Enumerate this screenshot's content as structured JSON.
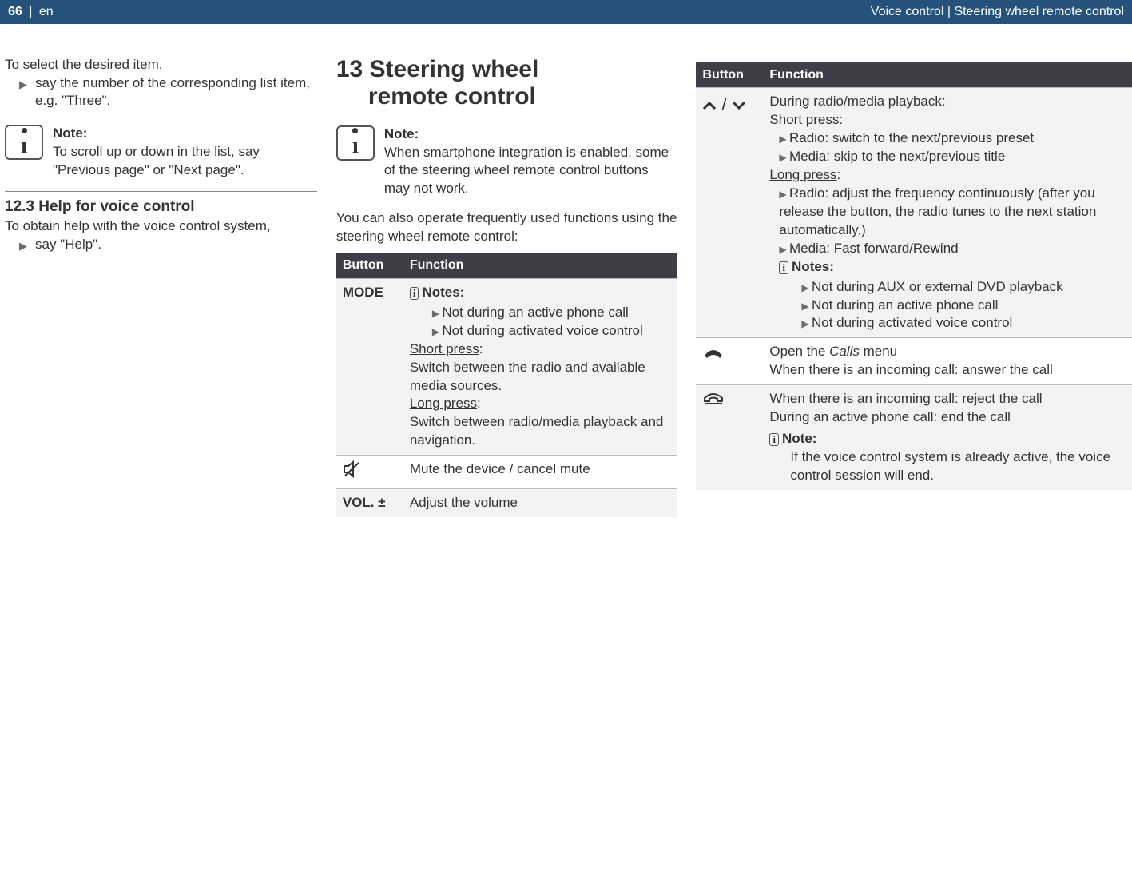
{
  "header": {
    "page_num": "66",
    "lang": "en",
    "title": "Voice control | Steering wheel remote control"
  },
  "col1": {
    "intro": "To select the desired item,",
    "bullet1": "say the number of the corresponding list item, e.g. \"Three\".",
    "note_label": "Note:",
    "note_body": "To scroll up or down in the list, say \"Previous page\" or \"Next page\".",
    "sec_num": "12.3",
    "sec_title": " Help for voice control",
    "help_intro": "To obtain help with the voice control system,",
    "help_bullet": "say \"Help\"."
  },
  "col2": {
    "h1_a": "13 Steering wheel",
    "h1_b": "remote control",
    "note_label": "Note:",
    "note_body": "When smartphone integration is enabled, some of the steering wheel remote control buttons may not work.",
    "intro": "You can also operate frequently used functions using the steering wheel remote control:",
    "th_button": "Button",
    "th_function": "Function",
    "mode_label": "MODE",
    "mode_notes_label": "Notes:",
    "mode_note1": "Not during an active phone call",
    "mode_note2": "Not during activated voice control",
    "mode_short_label": "Short press",
    "mode_short_body": "Switch between the radio and available media sources.",
    "mode_long_label": "Long press",
    "mode_long_body": "Switch between radio/media playback and navigation.",
    "mute_body": "Mute the device / cancel mute",
    "vol_label": "VOL. ±",
    "vol_body": "Adjust the volume"
  },
  "col3": {
    "th_button": "Button",
    "th_function": "Function",
    "arrows_intro": "During radio/media playback:",
    "short_label": "Short press",
    "short_b1": "Radio: switch to the next/previous preset",
    "short_b2": "Media: skip to the next/previous title",
    "long_label": "Long press",
    "long_b1": "Radio: adjust the frequency continuously (after you release the button, the radio tunes to the next station automatically.)",
    "long_b2": "Media: Fast forward/Rewind",
    "notes_label": "Notes:",
    "note1": "Not during AUX or external DVD playback",
    "note2": "Not during an active phone call",
    "note3": "Not during activated voice control",
    "pickup_a": "Open the ",
    "pickup_calls": "Calls",
    "pickup_b": " menu",
    "pickup_c": "When there is an incoming call: answer the call",
    "hangup_a": "When there is an incoming call: reject the call",
    "hangup_b": "During an active phone call: end the call",
    "hangup_note_label": "Note:",
    "hangup_note_body": "If the voice control system is already active, the voice control session will end."
  }
}
